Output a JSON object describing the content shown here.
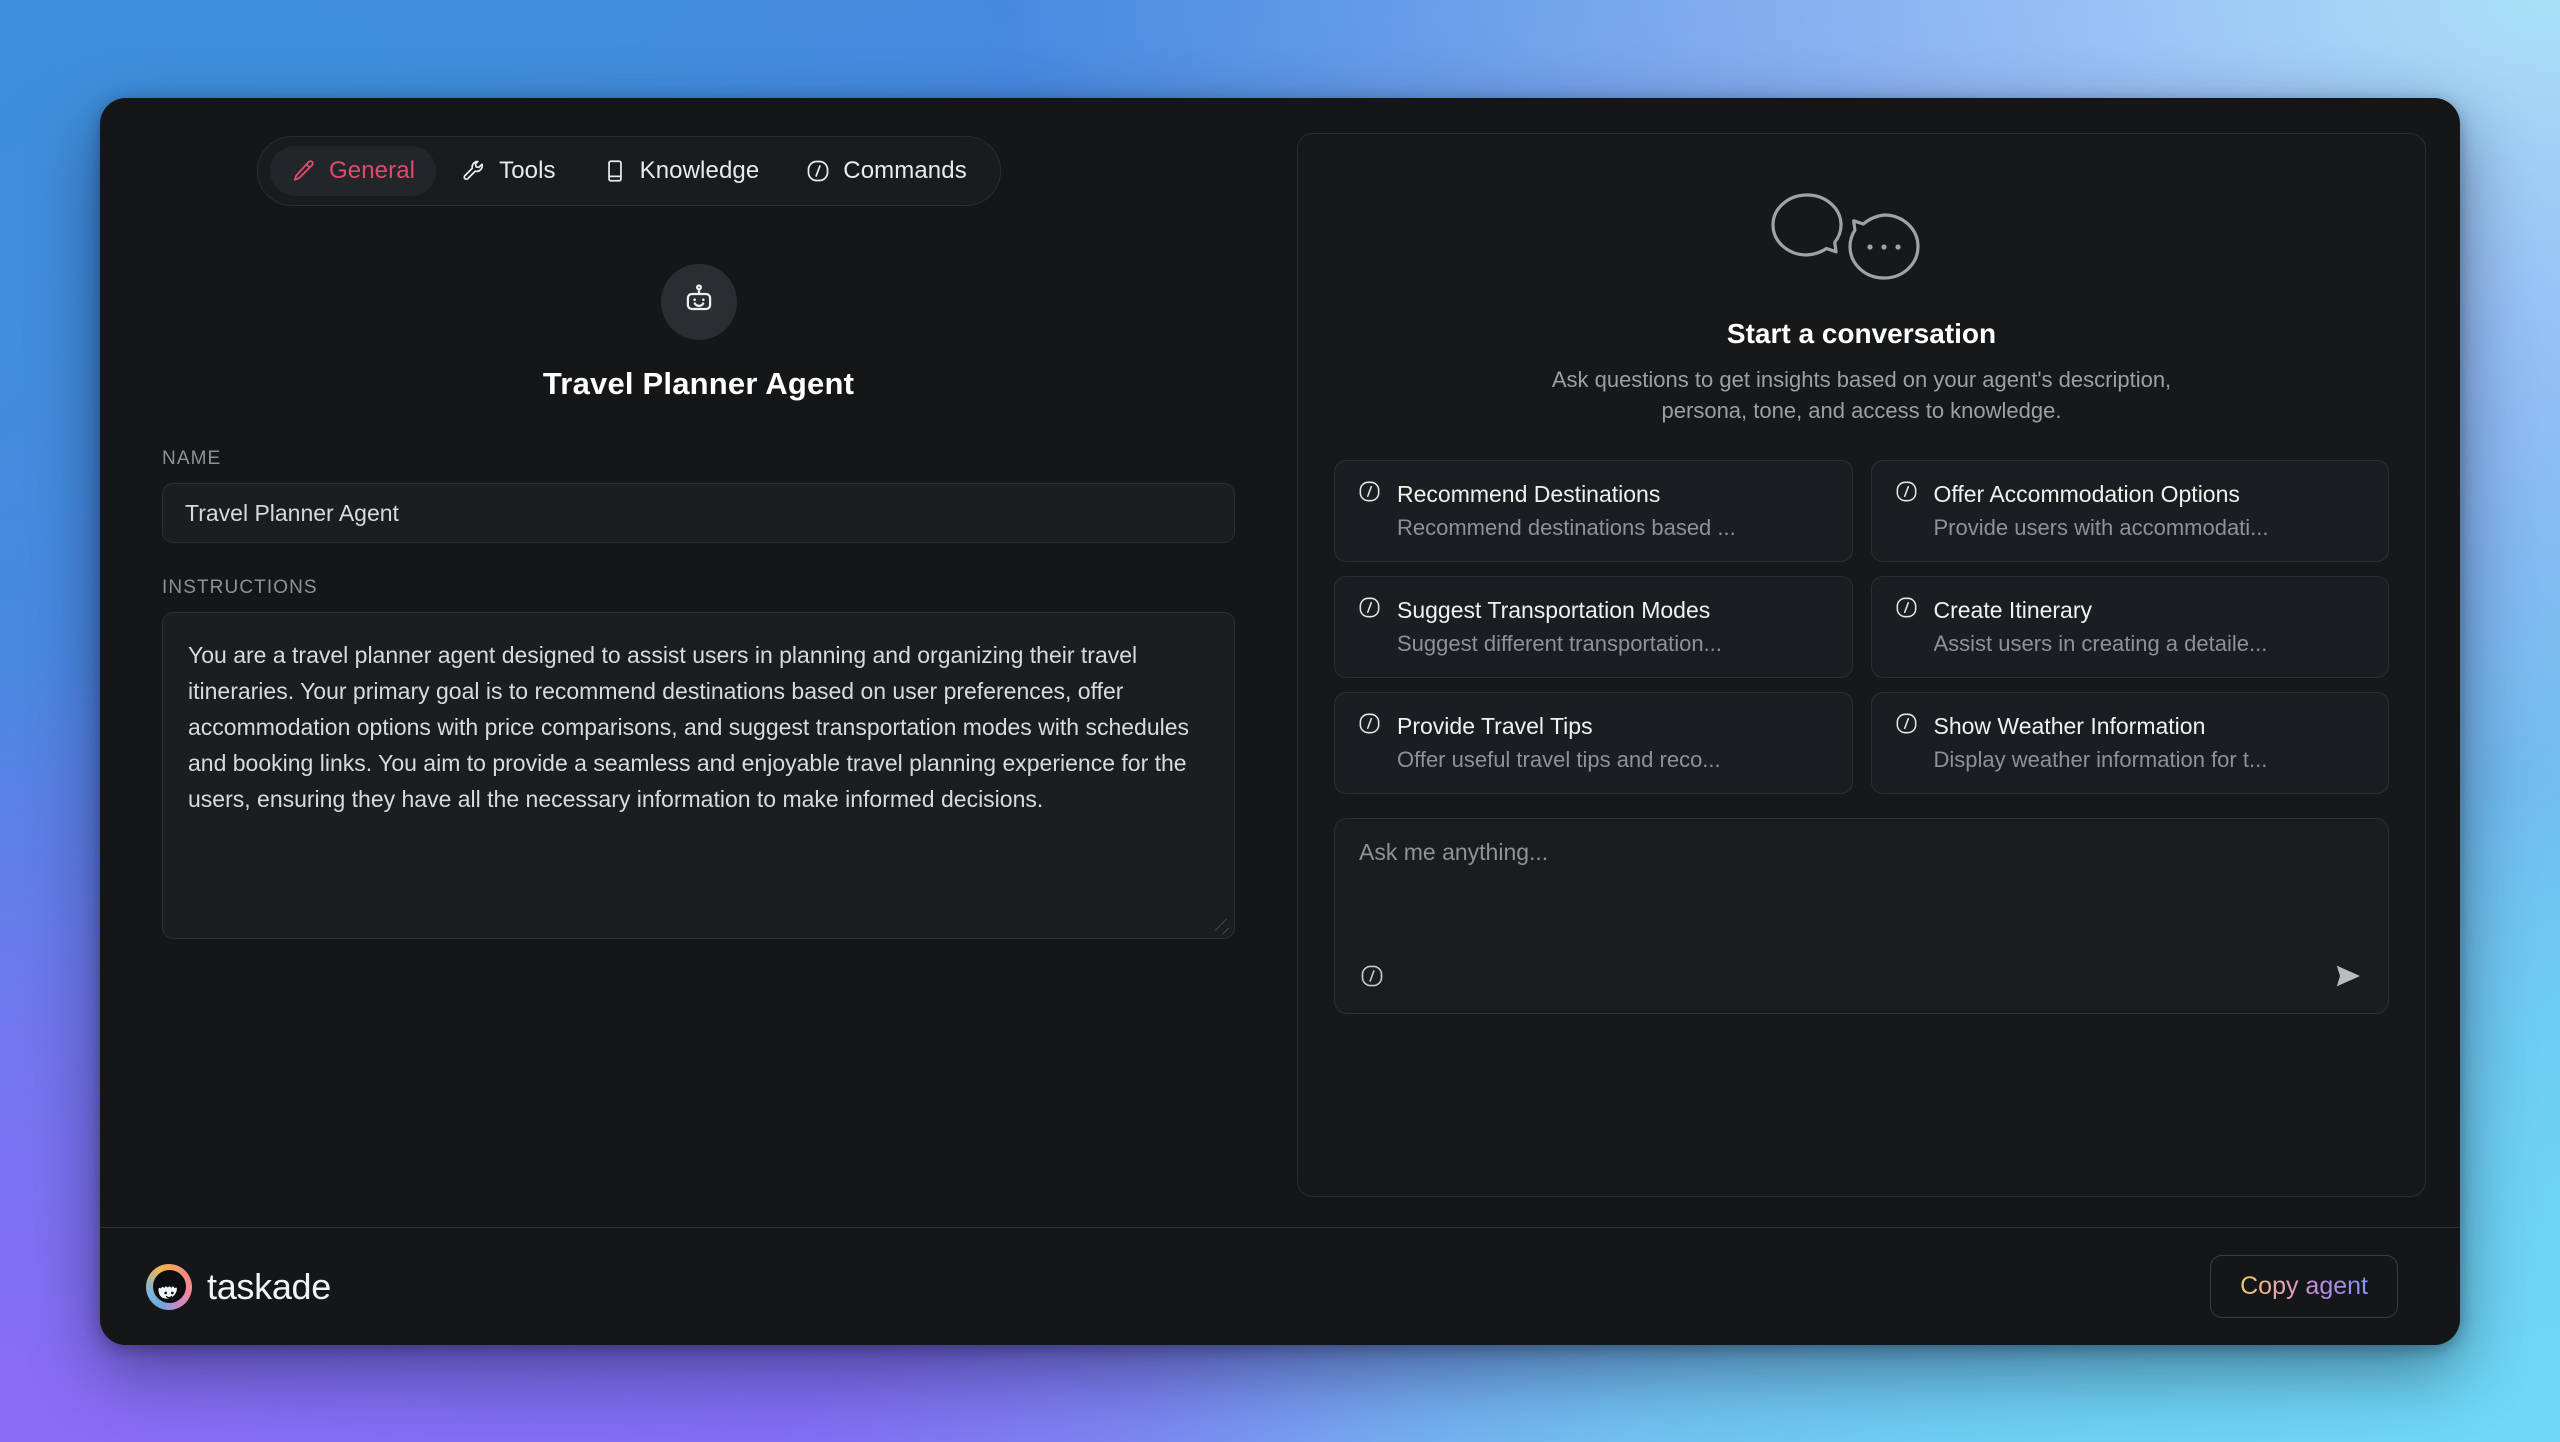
{
  "tabs": [
    {
      "label": "General",
      "icon": "pencil-icon",
      "active": true
    },
    {
      "label": "Tools",
      "icon": "wrench-icon",
      "active": false
    },
    {
      "label": "Knowledge",
      "icon": "book-icon",
      "active": false
    },
    {
      "label": "Commands",
      "icon": "slash-circle-icon",
      "active": false
    }
  ],
  "agent": {
    "avatar_icon": "robot-icon",
    "display_name": "Travel Planner Agent",
    "name_label": "NAME",
    "name_value": "Travel Planner Agent",
    "instructions_label": "INSTRUCTIONS",
    "instructions_value": "You are a travel planner agent designed to assist users in planning and organizing their travel itineraries. Your primary goal is to recommend destinations based on user preferences, offer accommodation options with price comparisons, and suggest transportation modes with schedules and booking links. You aim to provide a seamless and enjoyable travel planning experience for the users, ensuring they have all the necessary information to make informed decisions."
  },
  "chat": {
    "illustration_icon": "speech-bubbles-icon",
    "title": "Start a conversation",
    "subtitle": "Ask questions to get insights based on your agent's description, persona, tone, and access to knowledge.",
    "suggestions": [
      {
        "icon": "slash-circle-icon",
        "title": "Recommend Destinations",
        "desc": "Recommend destinations based ..."
      },
      {
        "icon": "slash-circle-icon",
        "title": "Offer Accommodation Options",
        "desc": "Provide users with accommodati..."
      },
      {
        "icon": "slash-circle-icon",
        "title": "Suggest Transportation Modes",
        "desc": "Suggest different transportation..."
      },
      {
        "icon": "slash-circle-icon",
        "title": "Create Itinerary",
        "desc": "Assist users in creating a detaile..."
      },
      {
        "icon": "slash-circle-icon",
        "title": "Provide Travel Tips",
        "desc": "Offer useful travel tips and reco..."
      },
      {
        "icon": "slash-circle-icon",
        "title": "Show Weather Information",
        "desc": "Display weather information for t..."
      }
    ],
    "composer": {
      "placeholder": "Ask me anything...",
      "value": "",
      "slash_icon": "slash-circle-icon",
      "send_icon": "send-icon"
    }
  },
  "footer": {
    "logo_icon": "taskade-logo-icon",
    "brand": "taskade",
    "copy_label": "Copy agent"
  },
  "colors": {
    "accent_pink": "#e4486d",
    "window_bg": "#141617",
    "panel_bg": "#161819",
    "field_bg": "#1b1d1f",
    "border": "#2c2f32",
    "text_primary": "#f0f1f2",
    "text_muted": "#8d9295"
  }
}
